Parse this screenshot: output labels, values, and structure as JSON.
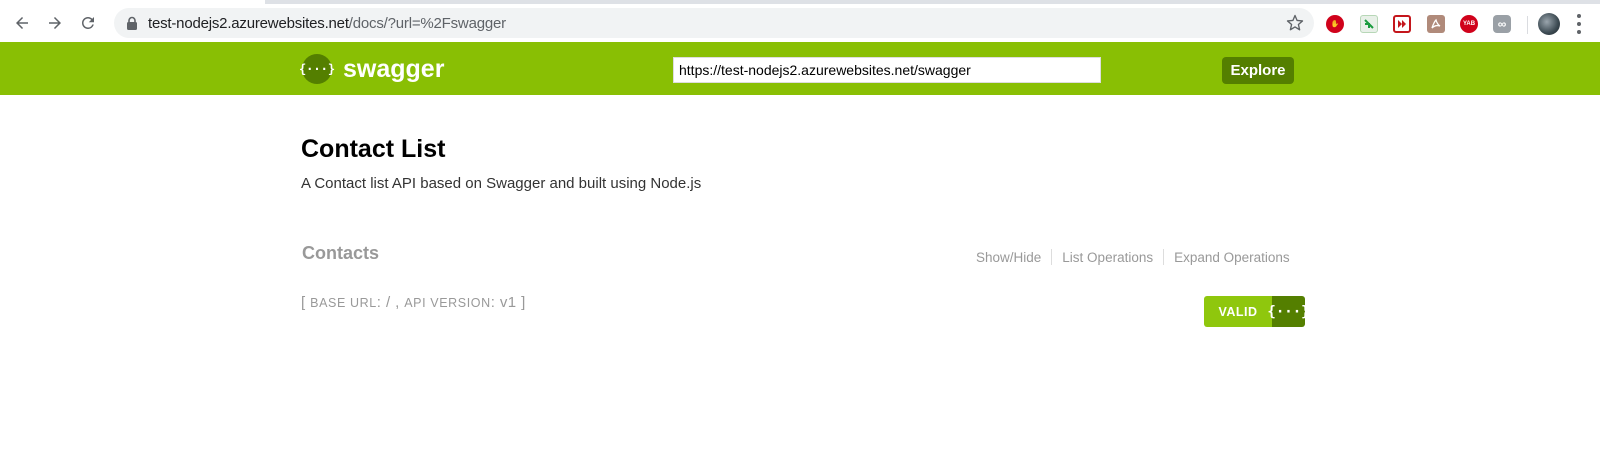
{
  "browser": {
    "url_host": "test-nodejs2.azurewebsites.net",
    "url_path": "/docs/?url=%2Fswagger",
    "extensions": [
      {
        "name": "adblock-extension-icon",
        "color": "#d0021b",
        "glyph": "✋"
      },
      {
        "name": "sheets-extension-icon",
        "color": "#e8f0e8",
        "glyph": ""
      },
      {
        "name": "media-extension-icon",
        "color": "#c4161c",
        "glyph": "▶"
      },
      {
        "name": "pdf-extension-icon",
        "color": "#b08a7a",
        "glyph": "A"
      },
      {
        "name": "yab-extension-icon",
        "color": "#d0021b",
        "glyph": "YAB"
      },
      {
        "name": "link-extension-icon",
        "color": "#9aa0a6",
        "glyph": "∞"
      }
    ]
  },
  "swagger": {
    "logo_glyph": "{···}",
    "brand": "swagger",
    "explore_input": "https://test-nodejs2.azurewebsites.net/swagger",
    "explore_label": "Explore"
  },
  "info": {
    "title": "Contact List",
    "description": "A Contact list API based on Swagger and built using Node.js"
  },
  "resource": {
    "name": "Contacts",
    "options": [
      "Show/Hide",
      "List Operations",
      "Expand Operations"
    ]
  },
  "footer": {
    "open_bracket": "[",
    "base_url_label": "BASE URL",
    "base_url_value": "/",
    "api_version_label": "API VERSION",
    "api_version_value": "v1",
    "close_bracket": "]"
  },
  "validator": {
    "label": "VALID",
    "icon_glyph": "{···}"
  }
}
